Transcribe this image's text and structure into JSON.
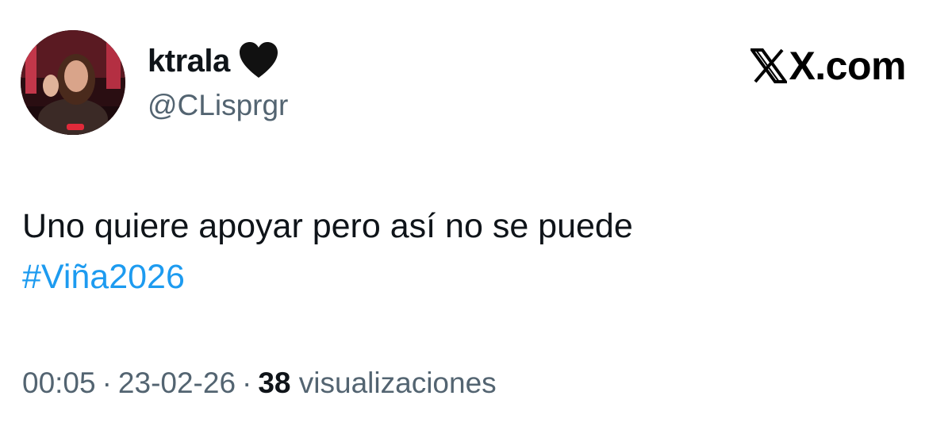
{
  "tweet": {
    "author": {
      "display_name": "ktrala",
      "emoji": "black-heart-icon",
      "handle": "@CLisprgr",
      "avatar": "avatar-photo"
    },
    "brand": {
      "text": "X.com",
      "icon": "x-logo-icon"
    },
    "text": "Uno quiere apoyar pero así no se puede",
    "hashtag": "#Viña2026",
    "meta": {
      "time": "00:05",
      "separator": "·",
      "date": "23-02-26",
      "views_count": "38",
      "views_label": "visualizaciones"
    },
    "colors": {
      "text": "#0f1419",
      "secondary": "#536471",
      "link": "#1d9bf0",
      "background": "#ffffff"
    }
  }
}
